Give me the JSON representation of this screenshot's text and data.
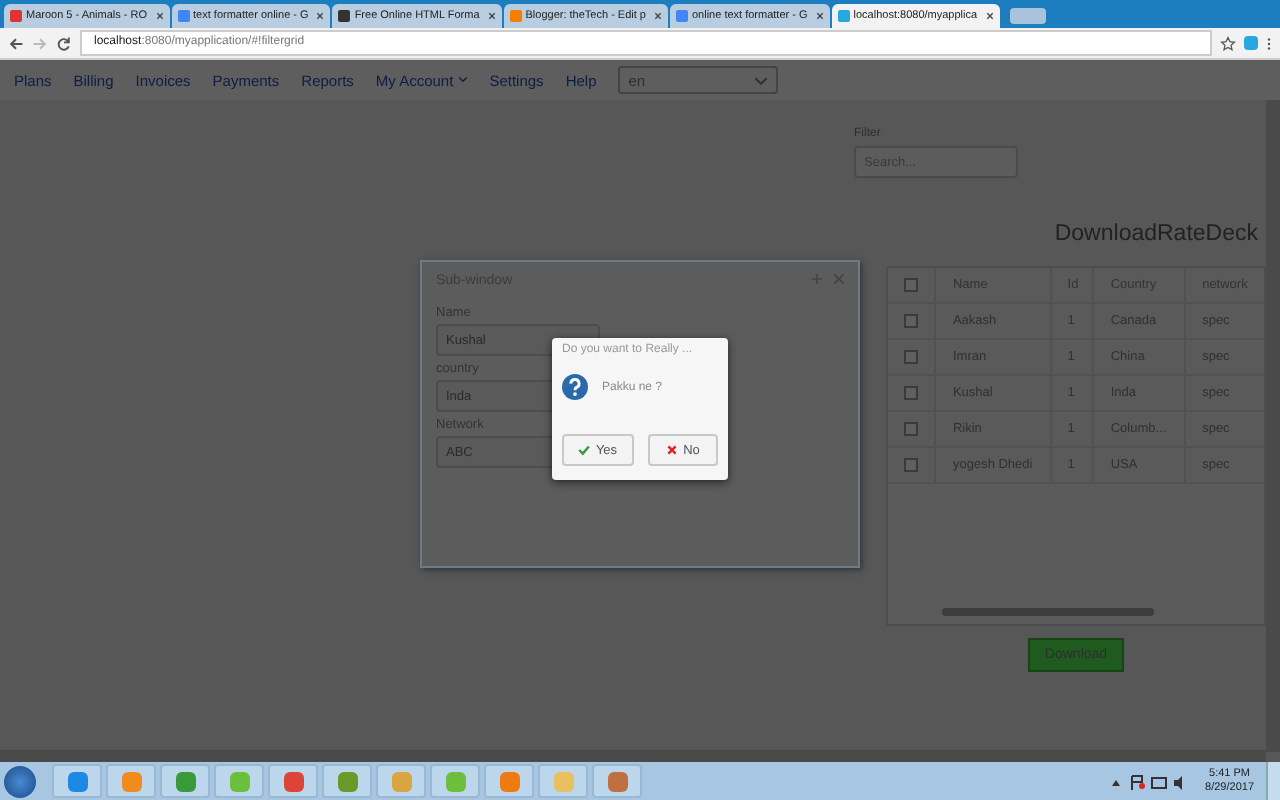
{
  "browser": {
    "tabs": [
      {
        "label": "Maroon 5 - Animals - RO",
        "selected": false
      },
      {
        "label": "text formatter online - G",
        "selected": false
      },
      {
        "label": "Free Online HTML Forma",
        "selected": false
      },
      {
        "label": "Blogger: theTech - Edit p",
        "selected": false
      },
      {
        "label": "online text formatter - G",
        "selected": false
      },
      {
        "label": "localhost:8080/myapplica",
        "selected": true
      }
    ],
    "address": {
      "host": "localhost",
      "rest": ":8080/myapplication/#!filtergrid"
    }
  },
  "nav": {
    "items": [
      {
        "label": "Plans",
        "dropdown": false
      },
      {
        "label": "Billing",
        "dropdown": false
      },
      {
        "label": "Invoices",
        "dropdown": false
      },
      {
        "label": "Payments",
        "dropdown": false
      },
      {
        "label": "Reports",
        "dropdown": false
      },
      {
        "label": "My Account",
        "dropdown": true
      },
      {
        "label": "Settings",
        "dropdown": false
      },
      {
        "label": "Help",
        "dropdown": false
      }
    ],
    "language": "en"
  },
  "filter": {
    "label": "Filter",
    "placeholder": "Search..."
  },
  "title": "DownloadRateDeck",
  "table": {
    "columns": [
      "Name",
      "Id",
      "Country",
      "network"
    ],
    "header_checked": false,
    "rows": [
      {
        "checked": false,
        "cells": [
          "Aakash",
          "1",
          "Canada",
          "spec"
        ]
      },
      {
        "checked": false,
        "cells": [
          "Imran",
          "1",
          "China",
          "spec"
        ]
      },
      {
        "checked": false,
        "cells": [
          "Kushal",
          "1",
          "Inda",
          "spec"
        ]
      },
      {
        "checked": false,
        "cells": [
          "Rikin",
          "1",
          "Columb...",
          "spec"
        ]
      },
      {
        "checked": false,
        "cells": [
          "yogesh Dhedi",
          "1",
          "USA",
          "spec"
        ]
      }
    ]
  },
  "download_button": "Download",
  "sub_window": {
    "title": "Sub-window",
    "fields": [
      {
        "label": "Name",
        "value": "Kushal"
      },
      {
        "label": "country",
        "value": "Inda"
      },
      {
        "label": "Network",
        "value": "ABC"
      }
    ]
  },
  "dialog": {
    "title": "Do you want to Really ...",
    "message": "Pakku ne ?",
    "buttons": [
      {
        "label": "Yes",
        "kind": "confirm"
      },
      {
        "label": "No",
        "kind": "cancel"
      }
    ]
  },
  "taskbar": {
    "time": "5:41 PM",
    "date": "8/29/2017"
  }
}
